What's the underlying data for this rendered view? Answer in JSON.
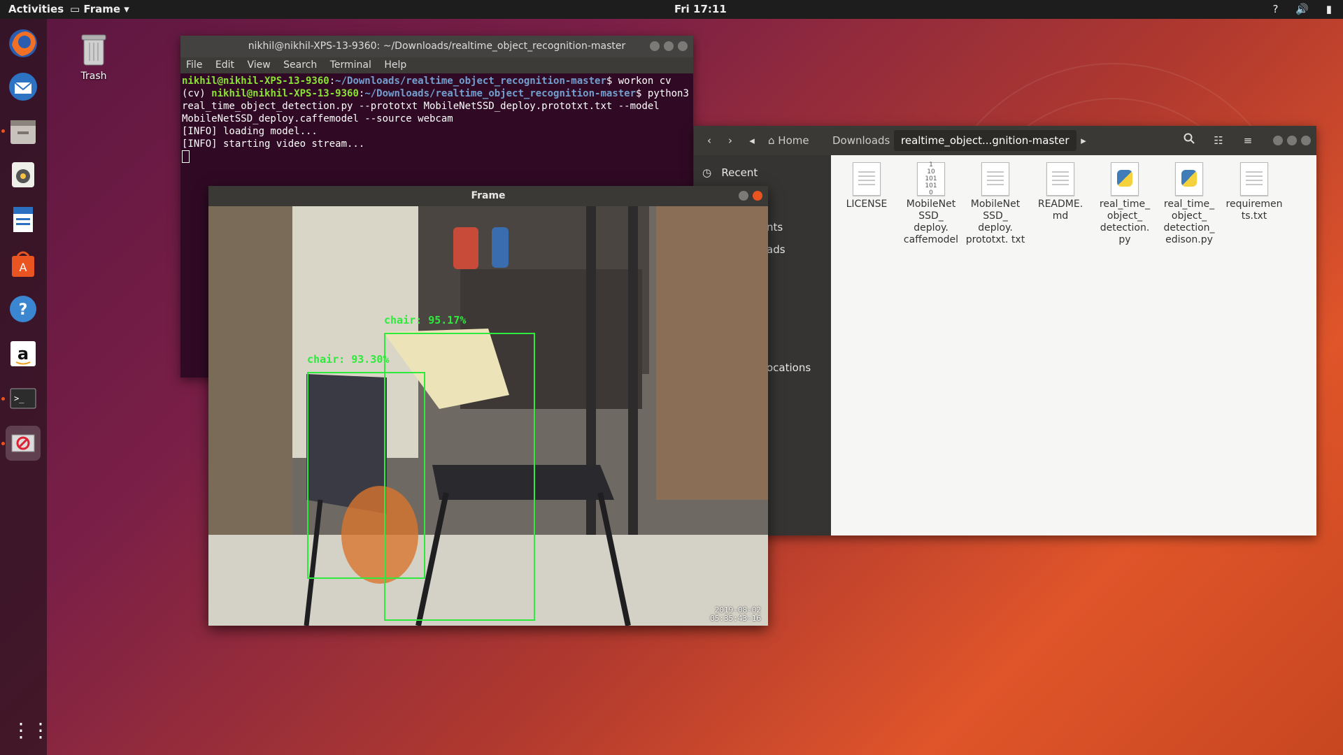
{
  "topbar": {
    "activities": "Activities",
    "app_menu": "Frame",
    "clock": "Fri 17:11",
    "tray": {
      "help": "?",
      "volume_icon": "volume-icon",
      "battery_icon": "battery-icon"
    }
  },
  "desktop": {
    "trash_label": "Trash"
  },
  "dock": {
    "items": [
      "firefox-icon",
      "thunderbird-icon",
      "files-icon",
      "rhythmbox-icon",
      "libreoffice-writer-icon",
      "software-center-icon",
      "help-icon",
      "amazon-icon",
      "terminal-icon",
      "frame-app-icon"
    ]
  },
  "terminal": {
    "title": "nikhil@nikhil-XPS-13-9360: ~/Downloads/realtime_object_recognition-master",
    "menu": [
      "File",
      "Edit",
      "View",
      "Search",
      "Terminal",
      "Help"
    ],
    "prompt_user": "nikhil@nikhil-XPS-13-9360",
    "prompt_path": "~/Downloads/realtime_object_recognition-master",
    "cmd1": "$ workon cv",
    "env": "(cv) ",
    "cmd2": "$ python3 real_time_object_detection.py --prototxt MobileNetSSD_deploy.prototxt.txt --model MobileNetSSD_deploy.caffemodel --source webcam",
    "out1": "[INFO] loading model...",
    "out2": "[INFO] starting video stream..."
  },
  "files": {
    "breadcrumbs": [
      "Home",
      "Downloads",
      "realtime_object...gnition-master"
    ],
    "sidebar": {
      "recent": "Recent",
      "frag1": "nts",
      "frag2": "ads",
      "frag3": "ocations"
    },
    "items": [
      {
        "name": "LICENSE",
        "type": "text"
      },
      {
        "name": "MobileNetSSD_deploy.caffemodel",
        "type": "binary",
        "label": "MobileNet SSD_ deploy. caffemodel"
      },
      {
        "name": "MobileNetSSD_deploy.prototxt.txt",
        "type": "text",
        "label": "MobileNet SSD_ deploy. prototxt. txt"
      },
      {
        "name": "README.md",
        "type": "text",
        "label": "README. md"
      },
      {
        "name": "real_time_object_detection.py",
        "type": "python",
        "label": "real_time_ object_ detection. py"
      },
      {
        "name": "real_time_object_detection_edison.py",
        "type": "python",
        "label": "real_time_ object_ detection_ edison.py"
      },
      {
        "name": "requirements.txt",
        "type": "text",
        "label": "requiremen ts.txt"
      }
    ],
    "binary_icon_text": "1 10 101 1010"
  },
  "frame": {
    "title": "Frame",
    "detections": [
      {
        "label": "chair: 95.17%"
      },
      {
        "label": "chair: 93.30%"
      }
    ],
    "timestamp_line1": "2019-08-02",
    "timestamp_line2": "05:35:43-16"
  },
  "colors": {
    "accent": "#e95420",
    "detection": "#2eea3c",
    "terminal_bg": "#300a24"
  }
}
